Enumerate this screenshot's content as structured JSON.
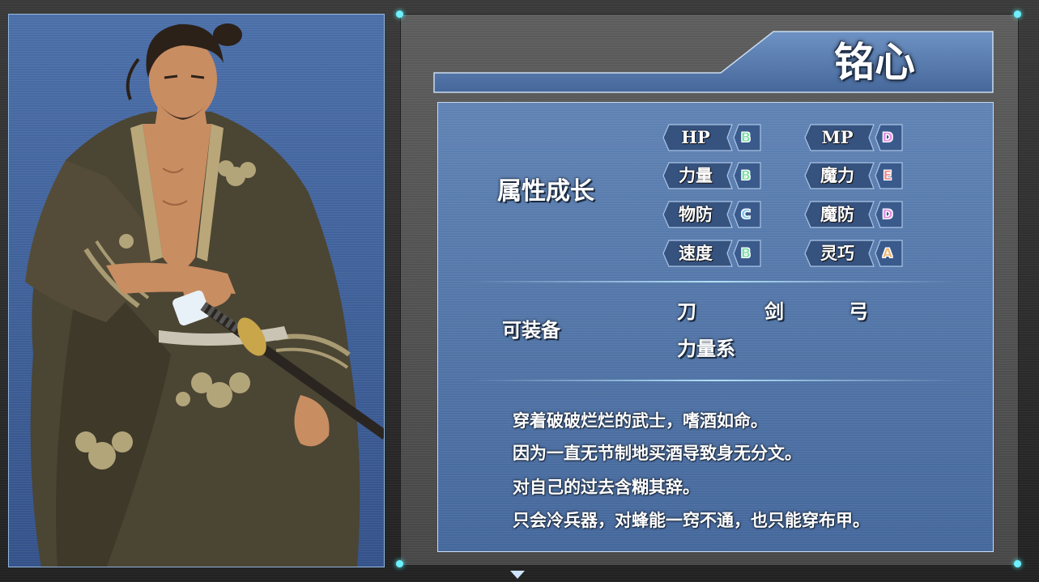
{
  "character": {
    "name": "铭心",
    "portrait": "samurai-portrait"
  },
  "growth": {
    "label": "属性成长",
    "stats": [
      {
        "label": "HP",
        "grade": "B",
        "color": "#7fe0a8"
      },
      {
        "label": "MP",
        "grade": "D",
        "color": "#e590e6"
      },
      {
        "label": "力量",
        "grade": "B",
        "color": "#7fe0a8"
      },
      {
        "label": "魔力",
        "grade": "E",
        "color": "#f08a8a"
      },
      {
        "label": "物防",
        "grade": "C",
        "color": "#7fc8f0"
      },
      {
        "label": "魔防",
        "grade": "D",
        "color": "#e590e6"
      },
      {
        "label": "速度",
        "grade": "B",
        "color": "#7fe0a8"
      },
      {
        "label": "灵巧",
        "grade": "A",
        "color": "#f0b470"
      }
    ]
  },
  "equipment": {
    "label": "可装备",
    "weapons": [
      "刀",
      "剑",
      "弓"
    ],
    "type": "力量系"
  },
  "description": [
    "穿着破破烂烂的武士，嗜酒如命。",
    "因为一直无节制地买酒导致身无分文。",
    "对自己的过去含糊其辞。",
    "只会冷兵器，对蜂能一窍不通，也只能穿布甲。"
  ],
  "colors": {
    "accent": "#6ff0ff",
    "panel_blue": "#5277aa"
  },
  "icons": {
    "scroll_hint": "down-arrow-icon",
    "corner_marker": "corner-dot-icon"
  }
}
